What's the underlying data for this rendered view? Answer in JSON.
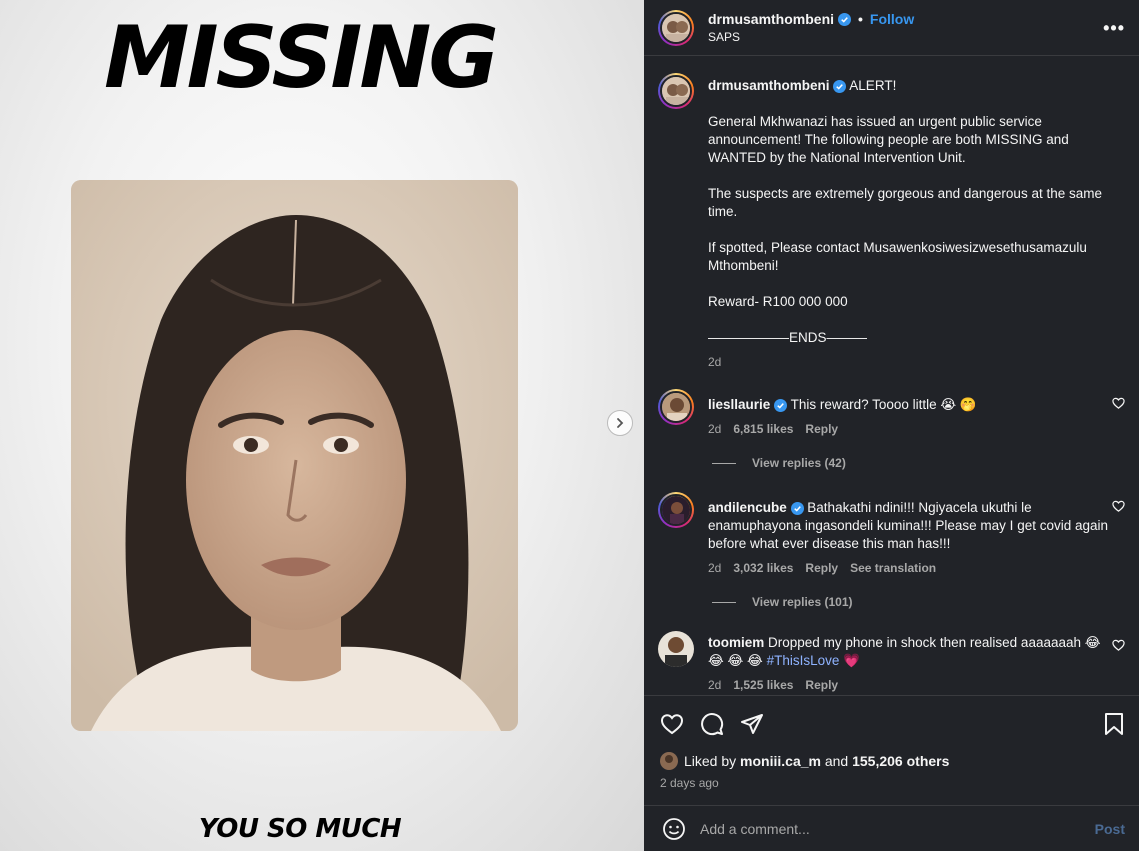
{
  "media": {
    "headline": "MISSING",
    "bottom_text": "YOU SO MUCH"
  },
  "header": {
    "username": "drmusamthombeni",
    "separator": "•",
    "follow_label": "Follow",
    "location": "SAPS",
    "more_label": "•••"
  },
  "caption": {
    "username": "drmusamthombeni",
    "first_line": "ALERT!",
    "paragraphs": [
      "General Mkhwanazi has issued an urgent public service announcement! The following people are both MISSING and WANTED by the National Intervention Unit.",
      "The suspects are extremely gorgeous and dangerous at the same time.",
      "If spotted, Please contact Musawenkosiwesizwesethusamazulu Mthombeni!",
      "Reward- R100 000 000",
      "——————ENDS———"
    ],
    "age": "2d"
  },
  "comments": [
    {
      "username": "liesllaurie",
      "text": "This reward? Toooo little 😭 🤭",
      "age": "2d",
      "likes": "6,815 likes",
      "reply": "Reply",
      "view_replies": "View replies (42)"
    },
    {
      "username": "andilencube",
      "text": "Bathakathi ndini!!! Ngiyacela ukuthi le enamuphayona ingasondeli kumina!!! Please may I get covid again before what ever disease this man has!!!",
      "age": "2d",
      "likes": "3,032 likes",
      "reply": "Reply",
      "translate": "See translation",
      "view_replies": "View replies (101)"
    },
    {
      "username": "toomiem",
      "text": "Dropped my phone in shock then realised aaaaaaah 😂 😂 😂 😂",
      "hashtag": "#ThisIsLove",
      "heart_emoji": "💗",
      "age": "2d",
      "likes": "1,525 likes",
      "reply": "Reply"
    }
  ],
  "footer": {
    "liked_by_prefix": "Liked by",
    "liked_by_user": "moniii.ca_m",
    "liked_by_and": "and",
    "liked_by_others": "155,206 others",
    "posted": "2 days ago",
    "comment_placeholder": "Add a comment...",
    "post_label": "Post"
  },
  "colors": {
    "panel_bg": "#212328",
    "link_blue": "#3897f0",
    "verified_blue": "#3897f0",
    "muted_text": "#a8a8a8"
  }
}
